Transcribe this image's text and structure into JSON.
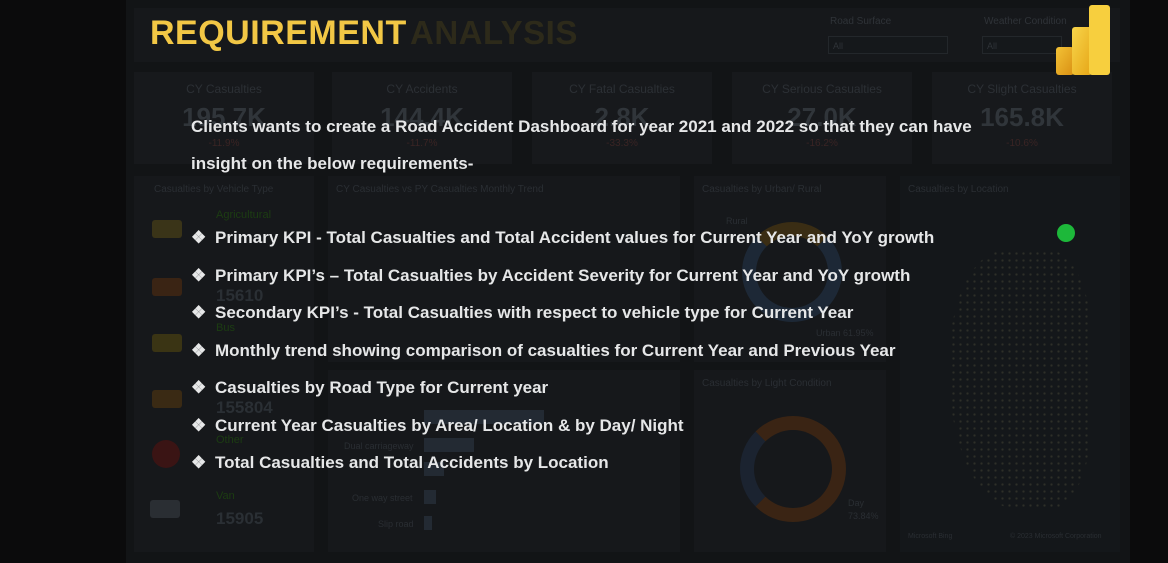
{
  "title": "REQUIREMENT",
  "background": {
    "title_ghost": "ANALYSIS",
    "filters": [
      {
        "label": "Road Surface",
        "value": "All"
      },
      {
        "label": "Weather Condition",
        "value": "All"
      }
    ],
    "kpis": [
      {
        "title": "CY Casualties",
        "value": "195.7K",
        "change": "-11.9%"
      },
      {
        "title": "CY Accidents",
        "value": "144.4K",
        "change": "-11.7%"
      },
      {
        "title": "CY Fatal Casualties",
        "value": "2.8K",
        "change": "-33.3%"
      },
      {
        "title": "CY Serious Casualties",
        "value": "27.0K",
        "change": "-16.2%"
      },
      {
        "title": "CY Slight Casualties",
        "value": "165.8K",
        "change": "-10.6%"
      }
    ],
    "panels": {
      "vehicle": "Casualties by Vehicle Type",
      "trend": "CY Casualties vs PY Casualties Monthly Trend",
      "urban": "Casualties by Urban/ Rural",
      "location": "Casualties by Location",
      "light": "Casualties by Light Condition"
    },
    "vehicles": [
      {
        "name": "Agricultural",
        "value": ""
      },
      {
        "name": "",
        "value": "15610"
      },
      {
        "name": "Bus",
        "value": ""
      },
      {
        "name": "",
        "value": "155804"
      },
      {
        "name": "Other",
        "value": ""
      },
      {
        "name": "Van",
        "value": "15905"
      }
    ],
    "urban_labels": {
      "rural": "Rural",
      "urban": "Urban 61.95%"
    },
    "light_labels": {
      "day": "Day",
      "day_pct": "73.84%"
    },
    "road_types": [
      "Dual carriageway",
      "One way street",
      "Slip road"
    ],
    "map_credits": {
      "left": "Microsoft Bing",
      "right": "© 2023 Microsoft Corporation"
    }
  },
  "intro": "Clients wants to create a Road Accident Dashboard for year 2021 and 2022 so that they can have insight on the below requirements-",
  "bullet": "❖",
  "requirements": [
    "Primary KPI - Total Casualties and Total Accident values for Current Year and YoY growth",
    "Primary KPI’s – Total Casualties by Accident Severity for Current Year and YoY growth",
    "Secondary KPI’s - Total Casualties with respect to vehicle type for Current Year",
    "Monthly trend showing comparison of casualties for Current Year and Previous Year",
    "Casualties by Road Type for Current year",
    "Current Year Casualties by Area/ Location & by Day/ Night",
    "Total Casualties and Total Accidents by Location"
  ],
  "colors": {
    "title": "#f2c745",
    "text": "#e6e7e8",
    "status_dot": "#1db83a"
  },
  "icons": [
    "power-bi-logo-icon",
    "status-dot-icon"
  ]
}
